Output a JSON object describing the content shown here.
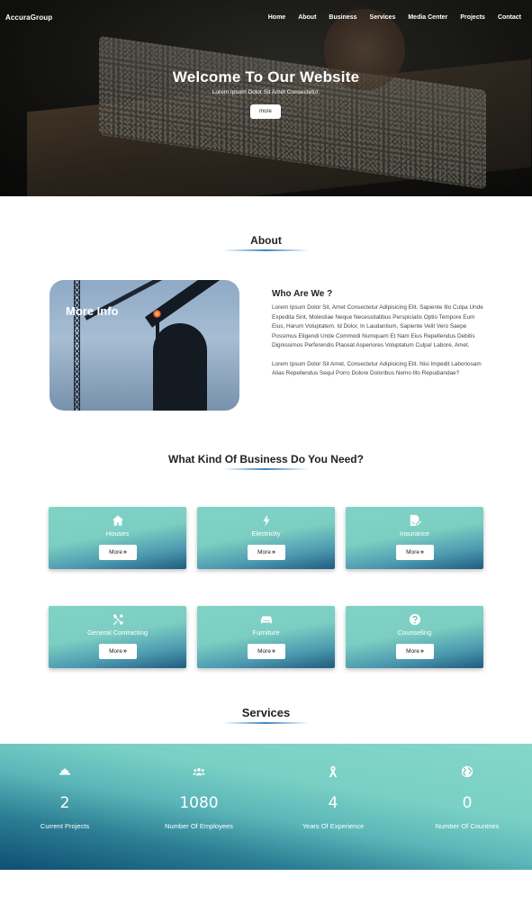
{
  "nav": {
    "brand": "AccuraGroup",
    "items": [
      {
        "label": "Home"
      },
      {
        "label": "About"
      },
      {
        "label": "Business"
      },
      {
        "label": "Services"
      },
      {
        "label": "Media Center"
      },
      {
        "label": "Projects"
      },
      {
        "label": "Contact"
      }
    ]
  },
  "hero": {
    "title": "Welcome To Our Website",
    "subtitle": "Lorem Ipsum Dolor Sit Amet Consectetur.",
    "button": "more"
  },
  "about": {
    "heading": "About",
    "image_caption": "More Info",
    "subheading": "Who Are We ?",
    "paragraph1": "Lorem Ipsum Dolor Sit, Amet Consectetur Adipisicing Elit. Sapiente Illo Culpa Unde Expedita Sint, Molestiae Neque Necessitatibus Perspiciatis Optio Tempore Eum Eius, Harum Voluptatem. Id Dolor, In Laudantium, Sapiente Velit Vero Saepe Possimus Eligendi Unde Commodi Numquam Et Nam Eius Repellendus Debitis Dignissimos Perferendis Placeat Asperiores Voluptatum Culpa! Labore, Amet.",
    "paragraph2": "Lorem Ipsum Dolor Sit Amet, Consectetur Adipisicing Elit. Nisi Impedit Laboriosam Alias Repellendus Sequi Porro Dolore Doloribus Nemo Illo Repudiandae?"
  },
  "business": {
    "heading": "What Kind Of Business Do You Need?",
    "button_label": "More",
    "cards": [
      {
        "label": "Houses",
        "icon": "home-icon"
      },
      {
        "label": "Electricity",
        "icon": "bolt-icon"
      },
      {
        "label": "Insurance",
        "icon": "file-signature-icon"
      },
      {
        "label": "General Contracting",
        "icon": "tools-icon"
      },
      {
        "label": "Furniture",
        "icon": "couch-icon"
      },
      {
        "label": "Counseling",
        "icon": "question-circle-icon"
      }
    ]
  },
  "services": {
    "heading": "Services",
    "stats": [
      {
        "value": "2",
        "label": "Current Projects",
        "icon": "hard-hat-icon"
      },
      {
        "value": "1080",
        "label": "Number Of Employees",
        "icon": "users-icon"
      },
      {
        "value": "4",
        "label": "Years Of Experience",
        "icon": "ribbon-icon"
      },
      {
        "value": "0",
        "label": "Number Of Countries",
        "icon": "globe-icon"
      }
    ]
  },
  "colors": {
    "accent_teal": "#7fd3c5",
    "accent_dark": "#1f5b7e",
    "underline_blue": "#3a85c8"
  }
}
